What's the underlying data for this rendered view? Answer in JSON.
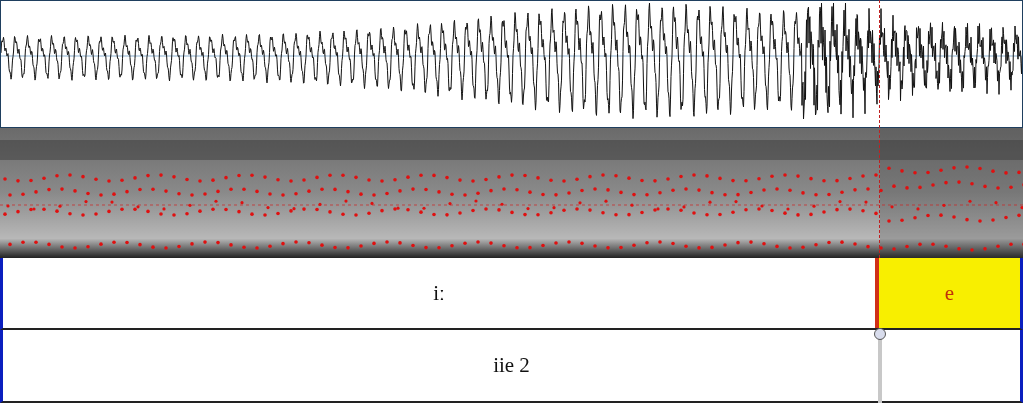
{
  "tiers": [
    {
      "intervals": [
        {
          "text": "iː",
          "selected": false
        },
        {
          "text": "e",
          "selected": true
        }
      ]
    },
    {
      "intervals": [
        {
          "text": "iie 2",
          "selected": false
        }
      ]
    }
  ]
}
